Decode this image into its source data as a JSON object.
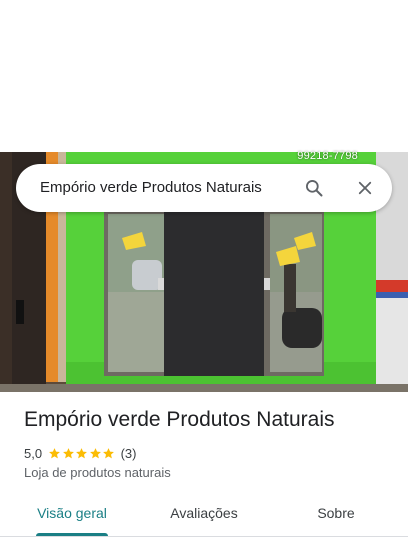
{
  "colors": {
    "accent": "#1a7f85",
    "star": "#fbbc04",
    "storefront_green": "#56d13a",
    "text_primary": "#202124",
    "text_secondary": "#5f6368"
  },
  "photo": {
    "phone_overlay": "99218-7798"
  },
  "search": {
    "query": "Empório verde Produtos Naturais",
    "search_icon": "search-icon",
    "close_icon": "close-icon"
  },
  "place": {
    "name": "Empório verde Produtos Naturais",
    "rating": "5,0",
    "stars": 5,
    "review_count": "(3)",
    "category": "Loja de produtos naturais"
  },
  "tabs": [
    {
      "label": "Visão geral",
      "selected": true
    },
    {
      "label": "Avaliações",
      "selected": false
    },
    {
      "label": "Sobre",
      "selected": false
    }
  ]
}
